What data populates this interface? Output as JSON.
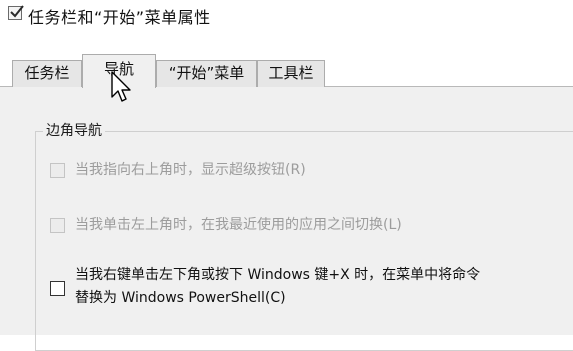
{
  "window": {
    "title": "任务栏和“开始”菜单属性",
    "icon": "checkbox-icon"
  },
  "tabs": [
    {
      "label": "任务栏",
      "active": false
    },
    {
      "label": "导航",
      "active": true
    },
    {
      "label": "“开始”菜单",
      "active": false
    },
    {
      "label": "工具栏",
      "active": false
    }
  ],
  "group": {
    "title": "边角导航"
  },
  "options": [
    {
      "label": "当我指向右上角时，显示超级按钮(R)",
      "checked": false,
      "enabled": false
    },
    {
      "label": "当我单击左上角时，在我最近使用的应用之间切换(L)",
      "checked": false,
      "enabled": false
    },
    {
      "label_line1": "当我右键单击左下角或按下 Windows 键+X 时，在菜单中将命令",
      "label_line2": "替换为 Windows PowerShell(C)",
      "checked": false,
      "enabled": true
    }
  ],
  "cursor": "arrow-cursor-icon"
}
